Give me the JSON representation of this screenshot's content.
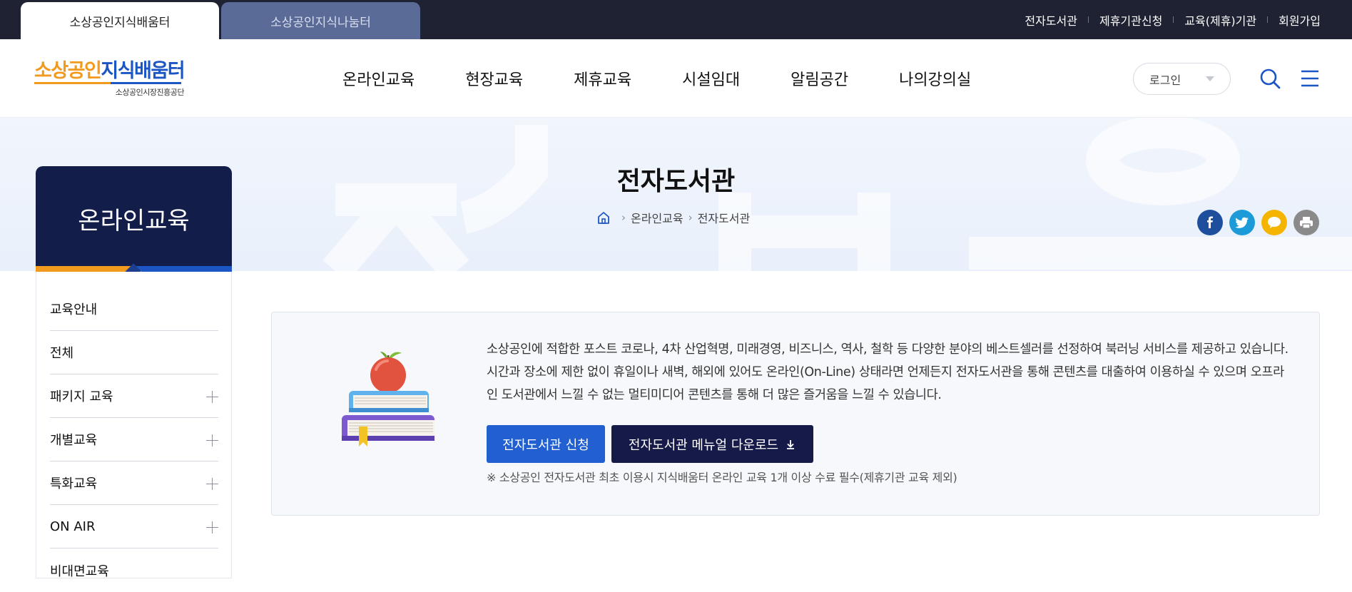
{
  "site_tabs": [
    {
      "label": "소상공인지식배움터",
      "active": true
    },
    {
      "label": "소상공인지식나눔터",
      "active": false
    }
  ],
  "util_links": [
    "전자도서관",
    "제휴기관신청",
    "교육(제휴)기관",
    "회원가입"
  ],
  "logo": {
    "main_orange": "소상공인",
    "main_blue": "지식배움터",
    "sub": "소상공인시장진흥공단"
  },
  "gnb": [
    "온라인교육",
    "현장교육",
    "제휴교육",
    "시설임대",
    "알림공간",
    "나의강의실"
  ],
  "login_select": {
    "value": "로그인"
  },
  "header_icons": [
    "search-icon",
    "menu-icon"
  ],
  "page": {
    "title": "전자도서관",
    "breadcrumb": [
      "온라인교육",
      "전자도서관"
    ]
  },
  "share_buttons": [
    {
      "name": "facebook",
      "color": "#1d4f9c"
    },
    {
      "name": "twitter",
      "color": "#1d9bd8"
    },
    {
      "name": "kakaotalk",
      "color": "#f5b400"
    },
    {
      "name": "print",
      "color": "#8a8a8a"
    }
  ],
  "lnb": {
    "title": "온라인교육",
    "items": [
      {
        "label": "교육안내",
        "expandable": false
      },
      {
        "label": "전체",
        "expandable": false
      },
      {
        "label": "패키지 교육",
        "expandable": true
      },
      {
        "label": "개별교육",
        "expandable": true
      },
      {
        "label": "특화교육",
        "expandable": true
      },
      {
        "label": "ON AIR",
        "expandable": true
      },
      {
        "label": "비대면교육",
        "expandable": false
      }
    ]
  },
  "content": {
    "description": "소상공인에 적합한 포스트 코로나, 4차 산업혁명, 미래경영, 비즈니스, 역사, 철학 등 다양한 분야의 베스트셀러를 선정하여 북러닝 서비스를 제공하고 있습니다. 시간과 장소에 제한 없이 휴일이나 새벽, 해외에 있어도 온라인(On-Line) 상태라면 언제든지 전자도서관을 통해 콘텐츠를 대출하여 이용하실 수 있으며 오프라인 도서관에서 느낄 수 없는 멀티미디어 콘텐츠를 통해 더 많은 즐거움을 느낄 수 있습니다.",
    "apply_button": "전자도서관 신청",
    "manual_button": "전자도서관 메뉴얼 다운로드",
    "note": "※ 소상공인 전자도서관 최초 이용시 지식배움터 온라인 교육 1개 이상 수료 필수(제휴기관 교육 제외)"
  },
  "colors": {
    "topbar_bg": "#1e2233",
    "brand_orange": "#f29a1d",
    "brand_blue": "#1b56c4",
    "lnb_head_bg": "#131d4a",
    "apply_btn": "#2260d2",
    "manual_btn": "#161a48"
  }
}
